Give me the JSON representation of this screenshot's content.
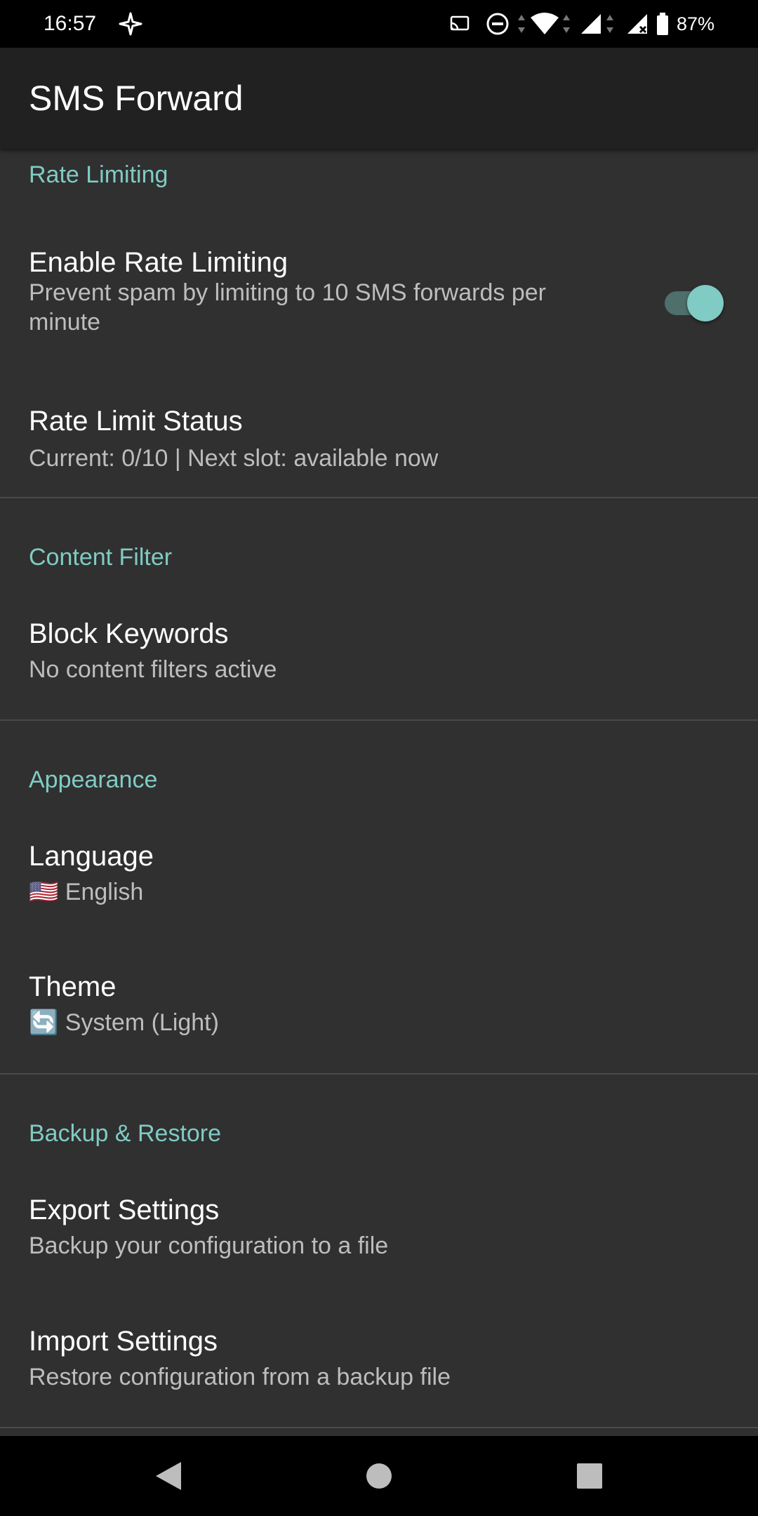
{
  "status_bar": {
    "time": "16:57",
    "battery_percent": "87%",
    "icons": [
      "location-icon",
      "cast-icon",
      "do-not-disturb-icon",
      "wifi-icon",
      "signal-icon",
      "signal-no-service-icon",
      "battery-icon"
    ]
  },
  "app_bar": {
    "title": "SMS Forward"
  },
  "sections": {
    "rate_limiting": {
      "header": "Rate Limiting",
      "enable": {
        "title": "Enable Rate Limiting",
        "summary": "Prevent spam by limiting to 10 SMS forwards per minute",
        "switch_on": true
      },
      "status": {
        "title": "Rate Limit Status",
        "summary": "Current: 0/10 | Next slot: available now"
      }
    },
    "content_filter": {
      "header": "Content Filter",
      "block_keywords": {
        "title": "Block Keywords",
        "summary": "No content filters active"
      }
    },
    "appearance": {
      "header": "Appearance",
      "language": {
        "title": "Language",
        "summary": "🇺🇸 English"
      },
      "theme": {
        "title": "Theme",
        "summary": "🔄 System (Light)"
      }
    },
    "backup_restore": {
      "header": "Backup & Restore",
      "export": {
        "title": "Export Settings",
        "summary": "Backup your configuration to a file"
      },
      "import": {
        "title": "Import Settings",
        "summary": "Restore configuration from a backup file"
      }
    }
  },
  "nav_bar": {
    "buttons": [
      "back-icon",
      "home-icon",
      "recents-icon"
    ]
  },
  "colors": {
    "accent": "#80CBC4",
    "background": "#303030",
    "app_bar": "#212121",
    "divider": "#4a4a4a"
  }
}
